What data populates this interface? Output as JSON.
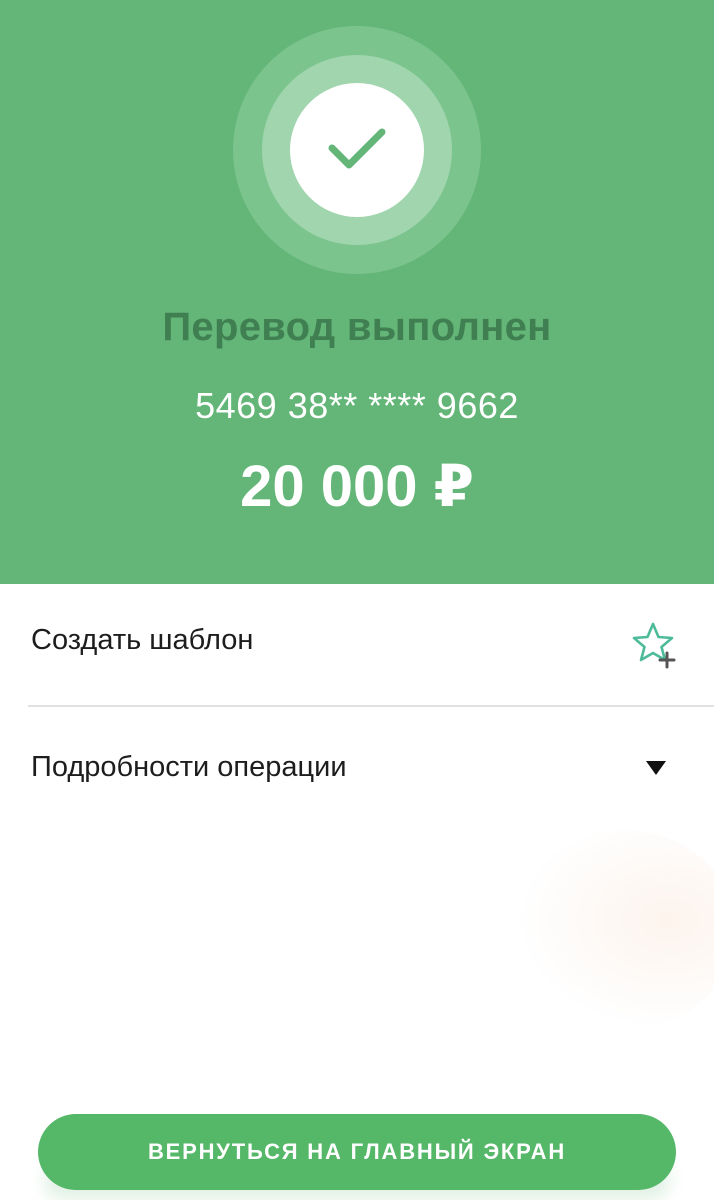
{
  "status": {
    "title": "Перевод выполнен",
    "card_number": "5469 38** **** 9662",
    "amount": "20 000 ₽",
    "icon": "checkmark-icon"
  },
  "actions": {
    "create_template": {
      "label": "Создать шаблон",
      "icon": "star-plus-icon"
    },
    "operation_details": {
      "label": "Подробности операции",
      "icon": "caret-down-icon"
    }
  },
  "main_button": {
    "label": "ВЕРНУТЬСЯ НА ГЛАВНЫЙ ЭКРАН"
  },
  "colors": {
    "header_bg": "#63b677",
    "title_text": "#3f7f51",
    "button_bg": "#55b768",
    "accent": "#4dbb9a"
  }
}
